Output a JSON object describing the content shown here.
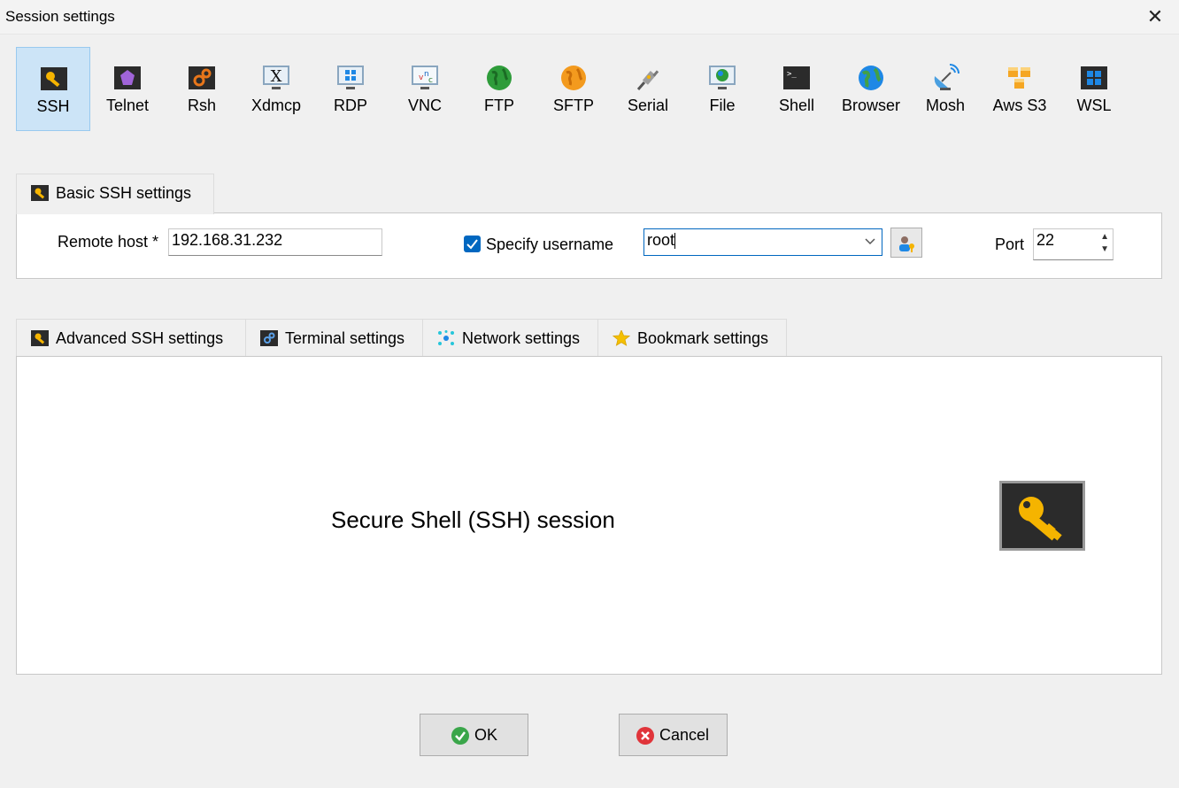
{
  "window": {
    "title": "Session settings"
  },
  "session_types": [
    {
      "label": "SSH",
      "icon": "key-icon",
      "selected": true
    },
    {
      "label": "Telnet",
      "icon": "telnet-gem-icon"
    },
    {
      "label": "Rsh",
      "icon": "rsh-gears-icon"
    },
    {
      "label": "Xdmcp",
      "icon": "x-monitor-icon"
    },
    {
      "label": "RDP",
      "icon": "windows-monitor-icon"
    },
    {
      "label": "VNC",
      "icon": "vnc-monitor-icon"
    },
    {
      "label": "FTP",
      "icon": "green-globe-icon"
    },
    {
      "label": "SFTP",
      "icon": "orange-globe-icon"
    },
    {
      "label": "Serial",
      "icon": "serial-plug-icon"
    },
    {
      "label": "File",
      "icon": "file-monitor-icon"
    },
    {
      "label": "Shell",
      "icon": "terminal-icon"
    },
    {
      "label": "Browser",
      "icon": "browser-globe-icon"
    },
    {
      "label": "Mosh",
      "icon": "satellite-dish-icon"
    },
    {
      "label": "Aws S3",
      "icon": "aws-cubes-icon"
    },
    {
      "label": "WSL",
      "icon": "windows-logo-icon"
    }
  ],
  "basic": {
    "tab_label": "Basic SSH settings",
    "remote_host_label": "Remote host *",
    "remote_host_value": "192.168.31.232",
    "specify_username_label": "Specify username",
    "specify_username_checked": true,
    "username_value": "root",
    "port_label": "Port",
    "port_value": "22"
  },
  "advanced_tabs": [
    {
      "label": "Advanced SSH settings",
      "icon": "key-icon"
    },
    {
      "label": "Terminal settings",
      "icon": "terminal-gears-icon"
    },
    {
      "label": "Network settings",
      "icon": "network-nodes-icon"
    },
    {
      "label": "Bookmark settings",
      "icon": "star-icon"
    }
  ],
  "content": {
    "session_description": "Secure Shell (SSH) session"
  },
  "buttons": {
    "ok": "OK",
    "cancel": "Cancel"
  },
  "colors": {
    "accent": "#0067c0",
    "selected_bg": "#cce4f7",
    "ok_green": "#3aa64a",
    "cancel_red": "#e0343a",
    "key_gold": "#f5b400"
  }
}
